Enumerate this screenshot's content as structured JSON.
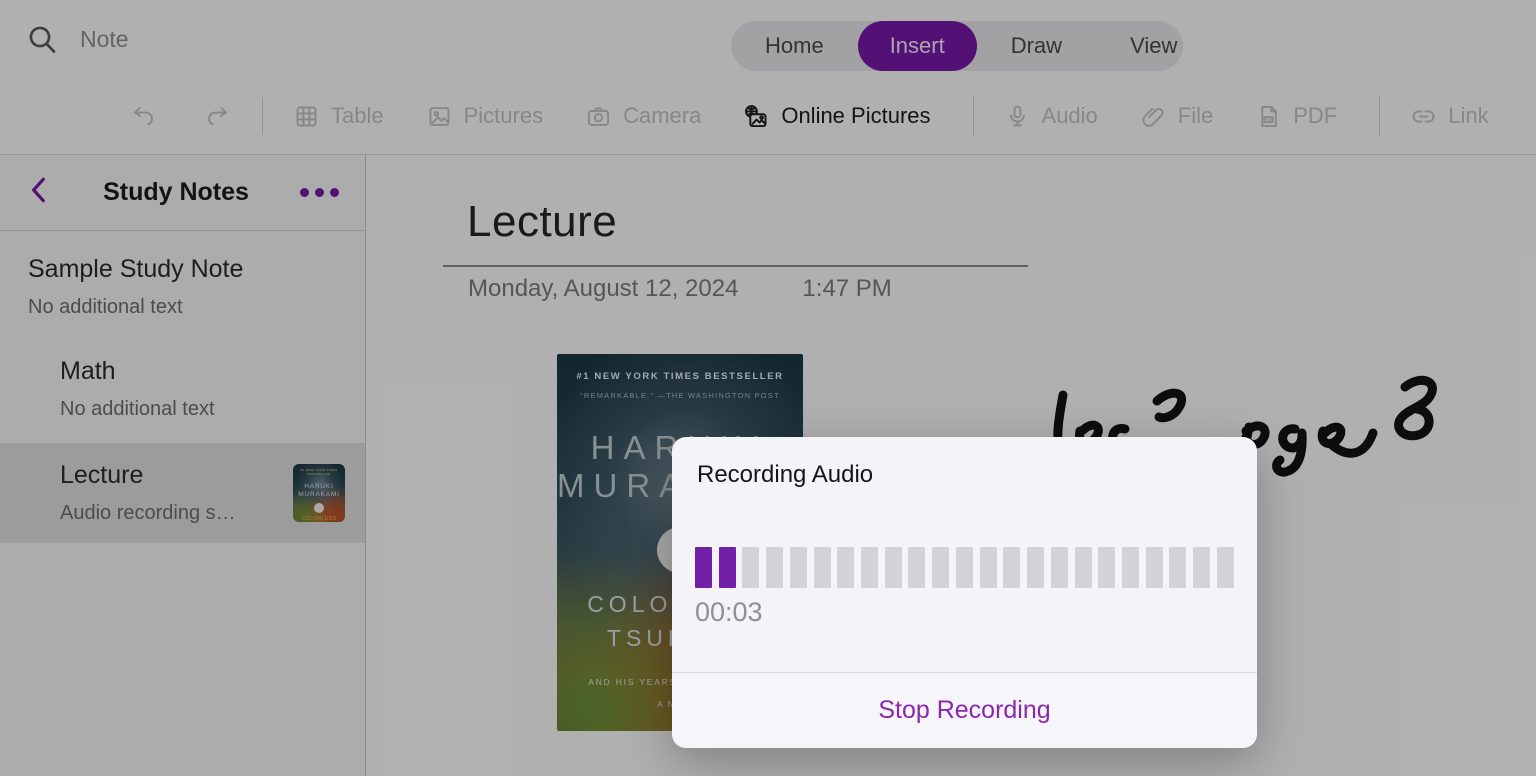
{
  "colors": {
    "accent_purple": "#7719aa",
    "meter_active_purple": "#7220a7",
    "meter_inactive_gray": "#d3d2d8",
    "stop_button_purple": "#8a28ad",
    "modal_background": "#f4f3f8",
    "selected_row_gray": "#e0e0e1"
  },
  "topbar": {
    "search_label": "Note",
    "tabs": [
      {
        "label": "Home",
        "selected": false
      },
      {
        "label": "Insert",
        "selected": true
      },
      {
        "label": "Draw",
        "selected": false
      },
      {
        "label": "View",
        "selected": false
      }
    ]
  },
  "toolbar": {
    "items": [
      {
        "label": "Table",
        "icon": "table-icon",
        "enabled": false
      },
      {
        "label": "Pictures",
        "icon": "pictures-icon",
        "enabled": false
      },
      {
        "label": "Camera",
        "icon": "camera-icon",
        "enabled": false
      },
      {
        "label": "Online Pictures",
        "icon": "online-pictures-icon",
        "enabled": true
      },
      {
        "label": "Audio",
        "icon": "audio-icon",
        "enabled": false
      },
      {
        "label": "File",
        "icon": "paperclip-icon",
        "enabled": false
      },
      {
        "label": "PDF",
        "icon": "pdf-icon",
        "enabled": false
      },
      {
        "label": "Link",
        "icon": "link-icon",
        "enabled": false
      }
    ]
  },
  "sidebar": {
    "title": "Study Notes",
    "notes": [
      {
        "title": "Sample Study Note",
        "subtitle": "No additional text",
        "selected": false
      },
      {
        "title": "Math",
        "subtitle": "No additional text",
        "selected": false
      },
      {
        "title": "Lecture",
        "subtitle": "Audio recording s…",
        "selected": true,
        "thumbnail": "book-cover-thumbnail"
      }
    ]
  },
  "page": {
    "title": "Lecture",
    "date": "Monday, August 12, 2024",
    "time": "1:47 PM",
    "handwriting": "Lec 3  pge 8",
    "book_cover": {
      "tagline": "#1 NEW YORK TIMES BESTSELLER",
      "review": "“REMARKABLE.” —THE WASHINGTON POST",
      "author_line1": "HARUKI",
      "author_line2": "MURAKAMI",
      "title_line1": "COLORLESS",
      "title_line2": "TSUKURU",
      "subtitle": "AND HIS YEARS OF PILGRIMAGE",
      "novel_mark": "A NOVEL"
    }
  },
  "modal": {
    "title": "Recording Audio",
    "elapsed": "00:03",
    "meter": {
      "total_bars": 23,
      "active_bars": 2
    },
    "stop_label": "Stop Recording"
  }
}
